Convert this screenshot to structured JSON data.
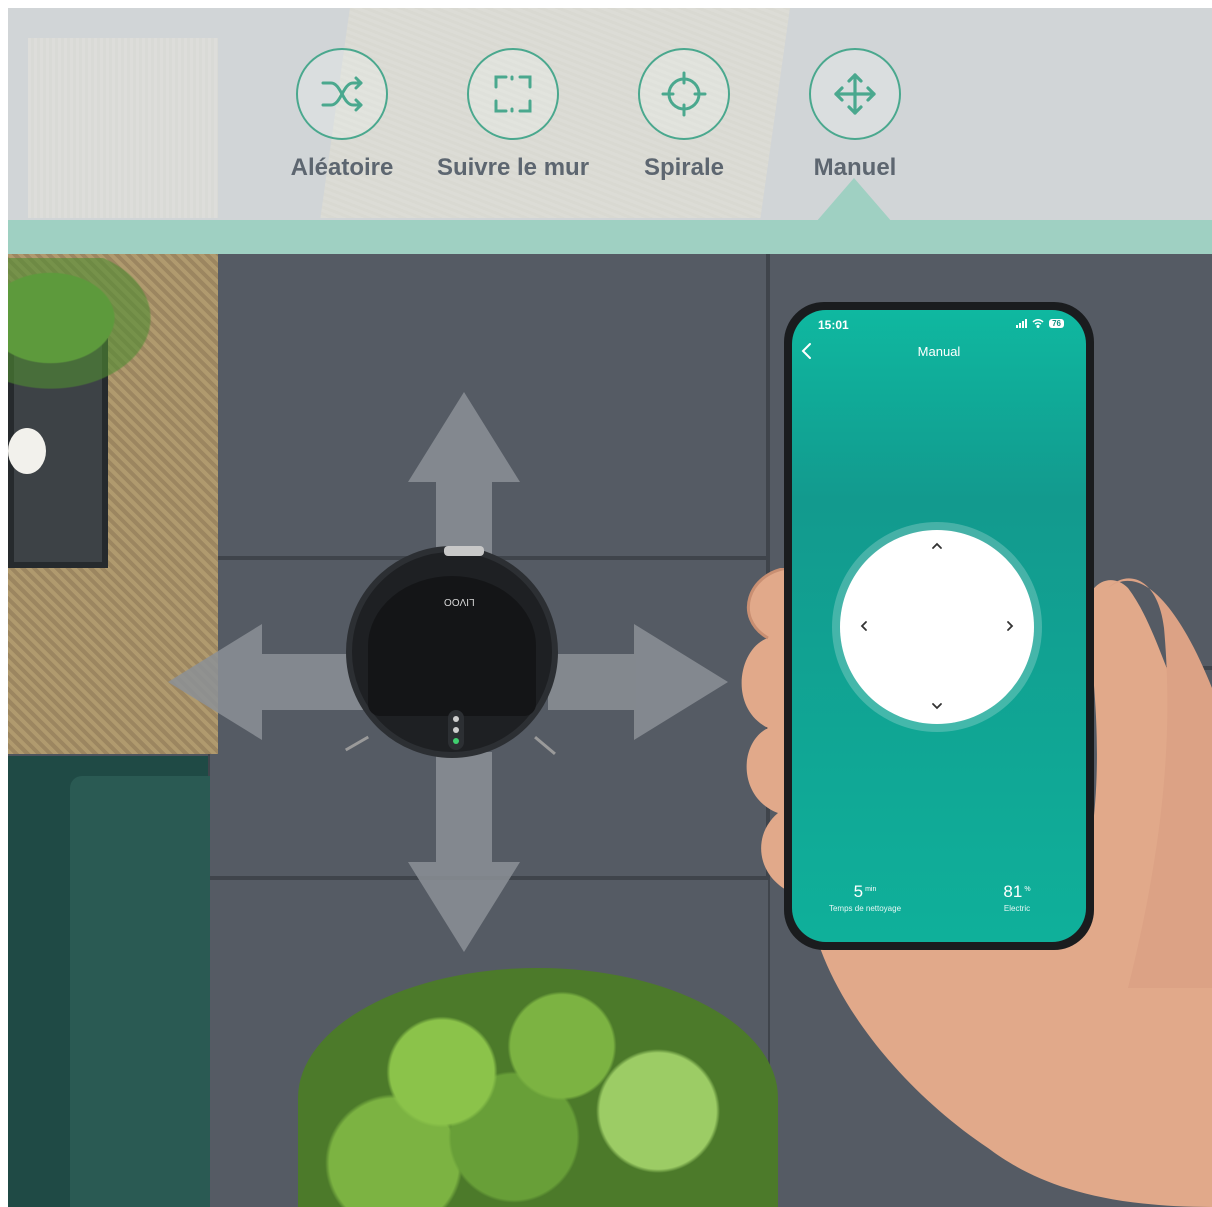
{
  "modes": [
    {
      "label": "Aléatoire",
      "icon": "shuffle-icon"
    },
    {
      "label": "Suivre le mur",
      "icon": "frame-corners-icon"
    },
    {
      "label": "Spirale",
      "icon": "crosshair-icon"
    },
    {
      "label": "Manuel",
      "icon": "move-arrows-icon"
    }
  ],
  "selected_mode": "Manuel",
  "robot": {
    "brand": "LIVOO"
  },
  "phone": {
    "status_time": "15:01",
    "battery_level": "76",
    "title": "Manual",
    "joystick": {
      "up": "^",
      "down": "v",
      "left": "<",
      "right": ">"
    },
    "stats": [
      {
        "value": "5",
        "unit": "min",
        "label": "Temps de nettoyage"
      },
      {
        "value": "81",
        "unit": "%",
        "label": "Electric"
      }
    ]
  },
  "colors": {
    "accent_teal": "#9fd0c2",
    "icon_green": "#4aa88e",
    "screen_teal": "#0fb8a0"
  }
}
